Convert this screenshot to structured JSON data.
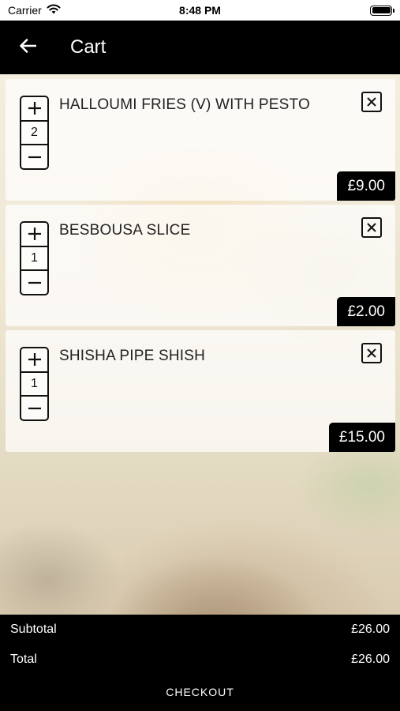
{
  "status_bar": {
    "carrier": "Carrier",
    "time": "8:48 PM"
  },
  "nav": {
    "title": "Cart"
  },
  "items": [
    {
      "name": "HALLOUMI FRIES (V) WITH PESTO",
      "quantity": "2",
      "price": "£9.00"
    },
    {
      "name": "BESBOUSA SLICE",
      "quantity": "1",
      "price": "£2.00"
    },
    {
      "name": "SHISHA PIPE SHISH",
      "quantity": "1",
      "price": "£15.00"
    }
  ],
  "summary": {
    "subtotal_label": "Subtotal",
    "subtotal_value": "£26.00",
    "total_label": "Total",
    "total_value": "£26.00",
    "checkout_label": "CHECKOUT"
  },
  "icons": {
    "back": "arrow-left-icon",
    "plus": "plus-icon",
    "minus": "minus-icon",
    "remove": "close-box-icon",
    "wifi": "wifi-icon",
    "battery": "battery-icon"
  },
  "colors": {
    "nav_bg": "#000000",
    "footer_bg": "#000000",
    "price_bg": "#000000"
  }
}
